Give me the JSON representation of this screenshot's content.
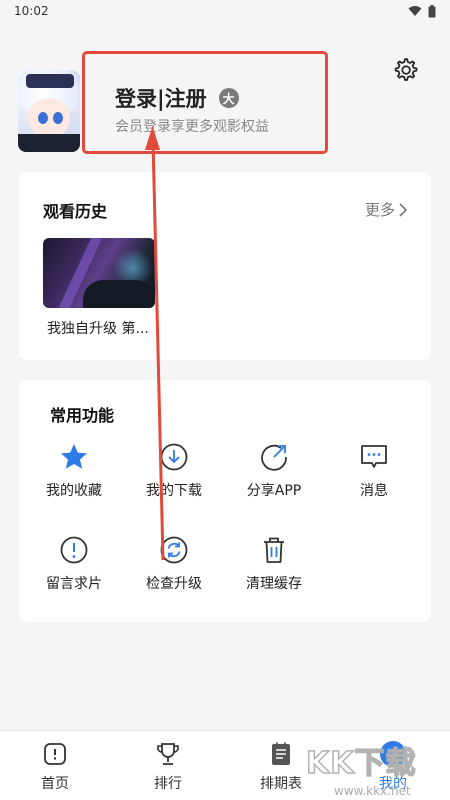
{
  "status_bar": {
    "time": "10:02"
  },
  "profile": {
    "login_title": "登录|注册",
    "badge_icon": "大",
    "login_subtitle": "会员登录享更多观影权益"
  },
  "history": {
    "title": "观看历史",
    "more_label": "更多",
    "items": [
      {
        "title": "我独自升级 第..."
      }
    ]
  },
  "functions": {
    "title": "常用功能",
    "items": [
      {
        "label": "我的收藏",
        "icon": "star-icon"
      },
      {
        "label": "我的下载",
        "icon": "download-icon"
      },
      {
        "label": "分享APP",
        "icon": "share-icon"
      },
      {
        "label": "消息",
        "icon": "message-icon"
      },
      {
        "label": "留言求片",
        "icon": "alert-circle-icon"
      },
      {
        "label": "检查升级",
        "icon": "refresh-icon"
      },
      {
        "label": "清理缓存",
        "icon": "trash-icon"
      }
    ]
  },
  "bottom_nav": {
    "items": [
      {
        "label": "首页",
        "icon": "home-icon"
      },
      {
        "label": "排行",
        "icon": "trophy-icon"
      },
      {
        "label": "排期表",
        "icon": "schedule-icon"
      },
      {
        "label": "我的",
        "icon": "profile-icon"
      }
    ],
    "active": "我的"
  },
  "watermark": {
    "logo": "KK下载",
    "url": "www.kkx.net"
  },
  "colors": {
    "accent": "#2f7be5",
    "annotation": "#e24a3b"
  }
}
